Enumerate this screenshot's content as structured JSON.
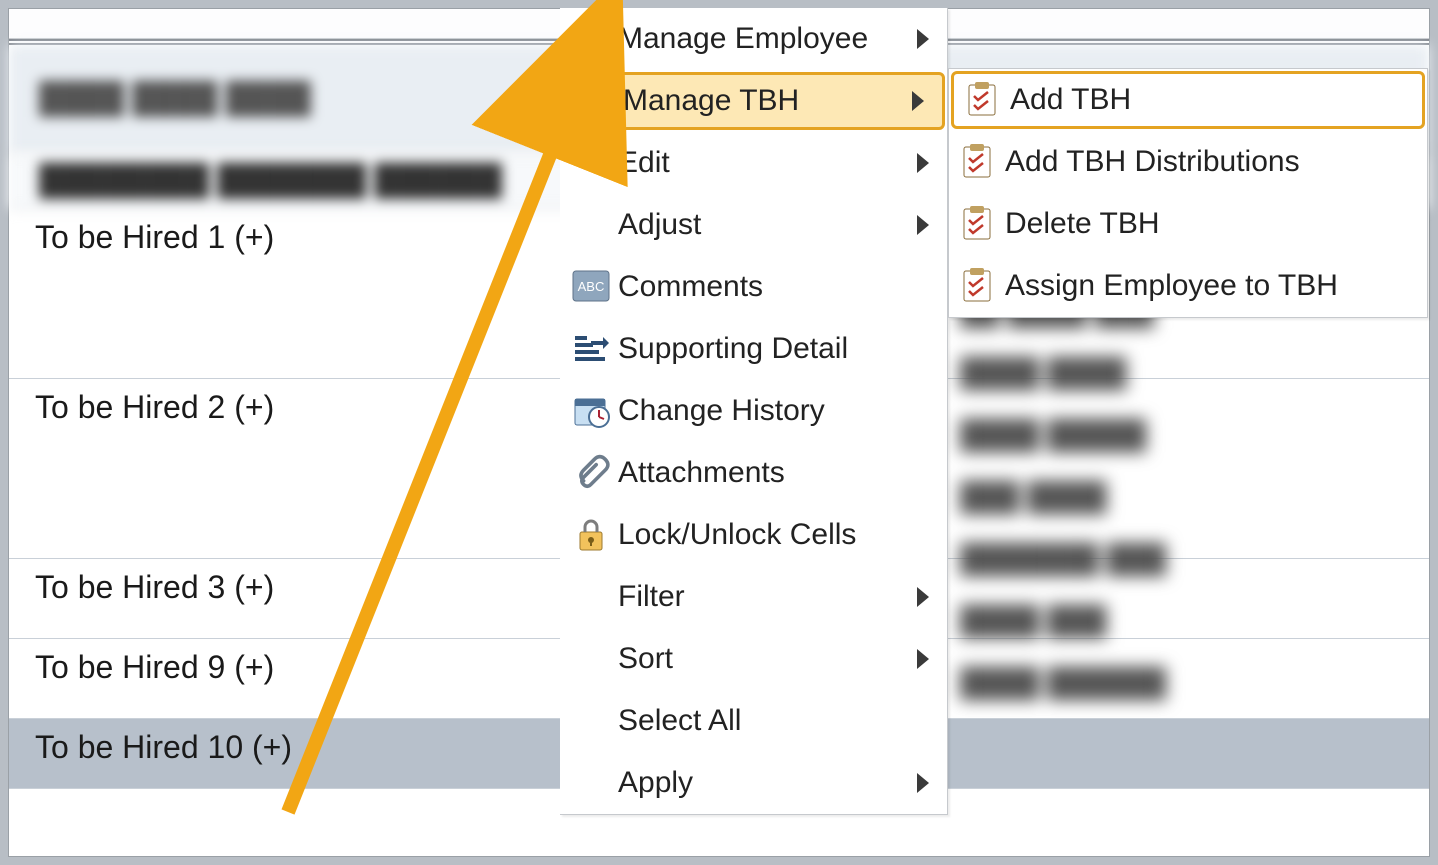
{
  "rows": [
    {
      "label": "To be Hired 1 (+)"
    },
    {
      "label": "To be Hired 2 (+)"
    },
    {
      "label": "To be Hired 3 (+)"
    },
    {
      "label": "To be Hired 9 (+)"
    },
    {
      "label": "To be Hired 10 (+)"
    }
  ],
  "context_menu": [
    {
      "label": "Manage Employee",
      "icon": "",
      "submenu": true,
      "highlight": false
    },
    {
      "label": "Manage TBH",
      "icon": "",
      "submenu": true,
      "highlight": true
    },
    {
      "label": "Edit",
      "icon": "",
      "submenu": true,
      "highlight": false
    },
    {
      "label": "Adjust",
      "icon": "",
      "submenu": true,
      "highlight": false
    },
    {
      "label": "Comments",
      "icon": "abc",
      "submenu": false,
      "highlight": false
    },
    {
      "label": "Supporting Detail",
      "icon": "steps",
      "submenu": false,
      "highlight": false
    },
    {
      "label": "Change History",
      "icon": "clock",
      "submenu": false,
      "highlight": false
    },
    {
      "label": "Attachments",
      "icon": "clip",
      "submenu": false,
      "highlight": false
    },
    {
      "label": "Lock/Unlock Cells",
      "icon": "lock",
      "submenu": false,
      "highlight": false
    },
    {
      "label": "Filter",
      "icon": "",
      "submenu": true,
      "highlight": false
    },
    {
      "label": "Sort",
      "icon": "",
      "submenu": true,
      "highlight": false
    },
    {
      "label": "Select All",
      "icon": "",
      "submenu": false,
      "highlight": false
    },
    {
      "label": "Apply",
      "icon": "",
      "submenu": true,
      "highlight": false
    }
  ],
  "sub_menu": [
    {
      "label": "Add TBH",
      "highlight": true
    },
    {
      "label": "Add TBH Distributions",
      "highlight": false
    },
    {
      "label": "Delete TBH",
      "highlight": false
    },
    {
      "label": "Assign Employee to TBH",
      "highlight": false
    }
  ]
}
